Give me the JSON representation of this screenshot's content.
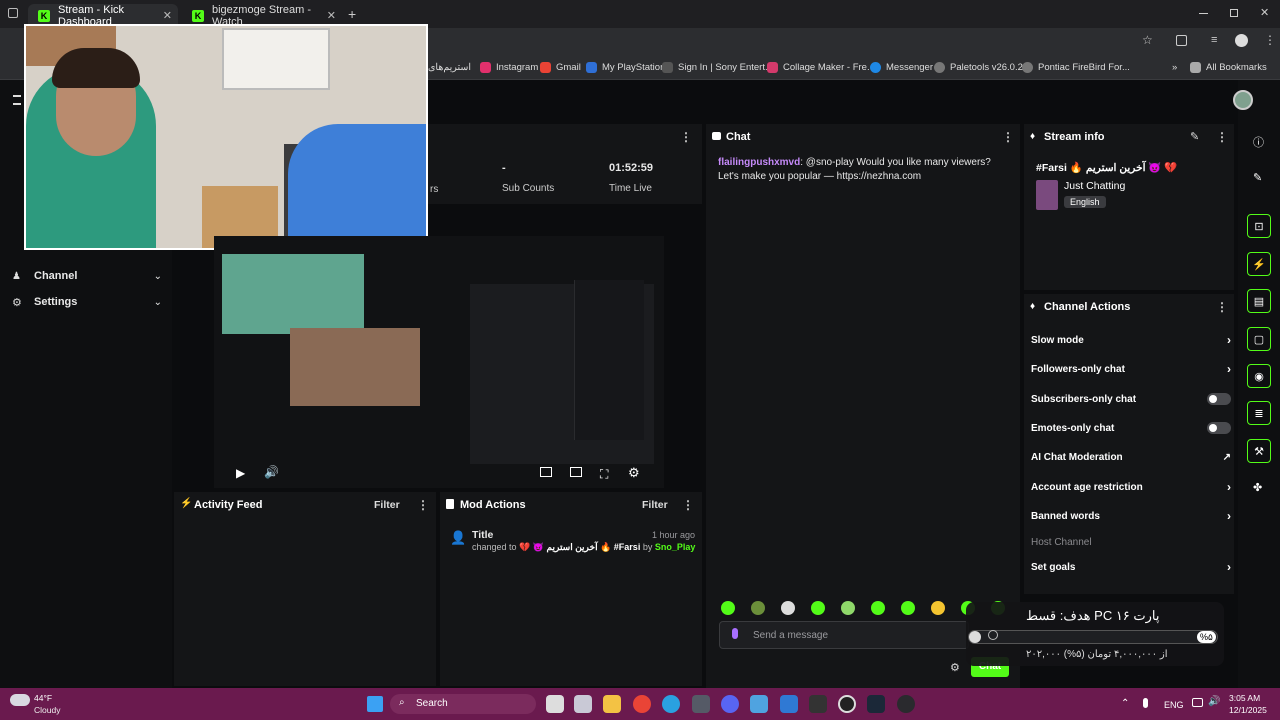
{
  "browser": {
    "tabs": [
      {
        "label": "Stream - Kick Dashboard",
        "close": "✕"
      },
      {
        "label": "bigezmoge Stream - Watch",
        "close": "✕"
      }
    ],
    "new_tab": "+",
    "bookmarks": [
      {
        "label": "استریم‌های",
        "color": "#888888"
      },
      {
        "label": "Instagram",
        "color": "#e1306c"
      },
      {
        "label": "Gmail",
        "color": "#ea4335"
      },
      {
        "label": "My PlayStation",
        "color": "#2f6fd6"
      },
      {
        "label": "Sign In | Sony Entert...",
        "color": "#555555"
      },
      {
        "label": "Collage Maker - Fre...",
        "color": "#d33a6b"
      },
      {
        "label": "Messenger",
        "color": "#1e88e5"
      },
      {
        "label": "Paletools v26.0.23",
        "color": "#777777"
      },
      {
        "label": "Pontiac FireBird For...",
        "color": "#777777"
      }
    ],
    "all_bookmarks": "All Bookmarks"
  },
  "sidebar": {
    "items": [
      {
        "label": "Channel"
      },
      {
        "label": "Settings"
      }
    ]
  },
  "stats": {
    "partial_label": "rs",
    "sub_counts_value": "-",
    "sub_counts_label": "Sub Counts",
    "time_live_value": "01:52:59",
    "time_live_label": "Time Live"
  },
  "chat": {
    "title": "Chat",
    "message_user": "flailingpushxmvd",
    "message_text": ": @sno-play Would you like many viewers? Let's make you popular — https://nezhna.com",
    "input_placeholder": "Send a message",
    "send_label": "Chat"
  },
  "stream_info": {
    "title": "Stream info",
    "stream_title": "#Farsi 🔥 آخرین استریم 😈 💔",
    "category": "Just Chatting",
    "language": "English"
  },
  "channel_actions": {
    "title": "Channel Actions",
    "items": [
      {
        "label": "Slow mode"
      },
      {
        "label": "Followers-only chat"
      },
      {
        "label": "Subscribers-only chat"
      },
      {
        "label": "Emotes-only chat"
      },
      {
        "label": "AI Chat Moderation"
      },
      {
        "label": "Account age restriction"
      },
      {
        "label": "Banned words"
      },
      {
        "label": "Host Channel"
      },
      {
        "label": "Set goals"
      }
    ]
  },
  "activity_feed": {
    "title": "Activity Feed",
    "filter": "Filter"
  },
  "mod_actions": {
    "title": "Mod Actions",
    "filter": "Filter",
    "entry_title": "Title",
    "entry_time": "1 hour ago",
    "entry_prefix": "changed to",
    "entry_value": "💔 😈 آخرین استریم 🔥 #Farsi",
    "entry_by": "by",
    "entry_user": "Sno_Play"
  },
  "goal_overlay": {
    "title": "هدف: قسط PC پارت ۱۶",
    "percent_label": "%۵",
    "progress_percent": 5,
    "amount_text": "۲۰۲,۰۰۰ از ۴,۰۰۰,۰۰۰ تومان (۵%)"
  },
  "taskbar": {
    "weather_temp": "44°F",
    "weather_desc": "Cloudy",
    "search": "Search",
    "lang": "ENG",
    "time": "3:05 AM",
    "date": "12/1/2025"
  },
  "colors": {
    "accent": "#53fc18",
    "username": "#c58af9",
    "taskbar": "#6a1a4e"
  }
}
